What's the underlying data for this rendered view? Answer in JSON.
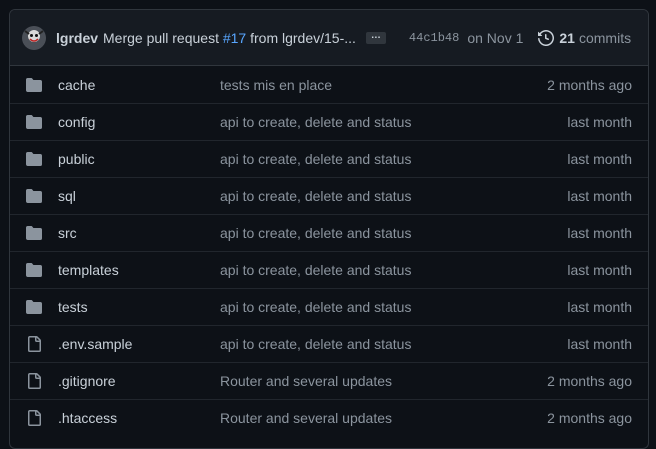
{
  "commit": {
    "author": "lgrdev",
    "message_prefix": "Merge pull request ",
    "pr_ref": "#17",
    "message_suffix": " from lgrdev/15-...",
    "ellipsis": "…",
    "sha": "44c1b48",
    "date": "on Nov 1",
    "commit_count": "21",
    "commits_label": "commits"
  },
  "files": [
    {
      "type": "dir",
      "icon": "folder-icon",
      "name": "cache",
      "message": "tests mis en place",
      "age": "2 months ago"
    },
    {
      "type": "dir",
      "icon": "folder-icon",
      "name": "config",
      "message": "api to create, delete and status",
      "age": "last month"
    },
    {
      "type": "dir",
      "icon": "folder-icon",
      "name": "public",
      "message": "api to create, delete and status",
      "age": "last month"
    },
    {
      "type": "dir",
      "icon": "folder-icon",
      "name": "sql",
      "message": "api to create, delete and status",
      "age": "last month"
    },
    {
      "type": "dir",
      "icon": "folder-icon",
      "name": "src",
      "message": "api to create, delete and status",
      "age": "last month"
    },
    {
      "type": "dir",
      "icon": "folder-icon",
      "name": "templates",
      "message": "api to create, delete and status",
      "age": "last month"
    },
    {
      "type": "dir",
      "icon": "folder-icon",
      "name": "tests",
      "message": "api to create, delete and status",
      "age": "last month"
    },
    {
      "type": "file",
      "icon": "file-icon",
      "name": ".env.sample",
      "message": "api to create, delete and status",
      "age": "last month"
    },
    {
      "type": "file",
      "icon": "file-icon",
      "name": ".gitignore",
      "message": "Router and several updates",
      "age": "2 months ago"
    },
    {
      "type": "file",
      "icon": "file-icon",
      "name": ".htaccess",
      "message": "Router and several updates",
      "age": "2 months ago"
    }
  ],
  "colors": {
    "background": "#0d1117",
    "header_bg": "#161b22",
    "border": "#30363d",
    "link": "#58a6ff",
    "muted": "#8b949e",
    "text": "#c9d1d9"
  }
}
